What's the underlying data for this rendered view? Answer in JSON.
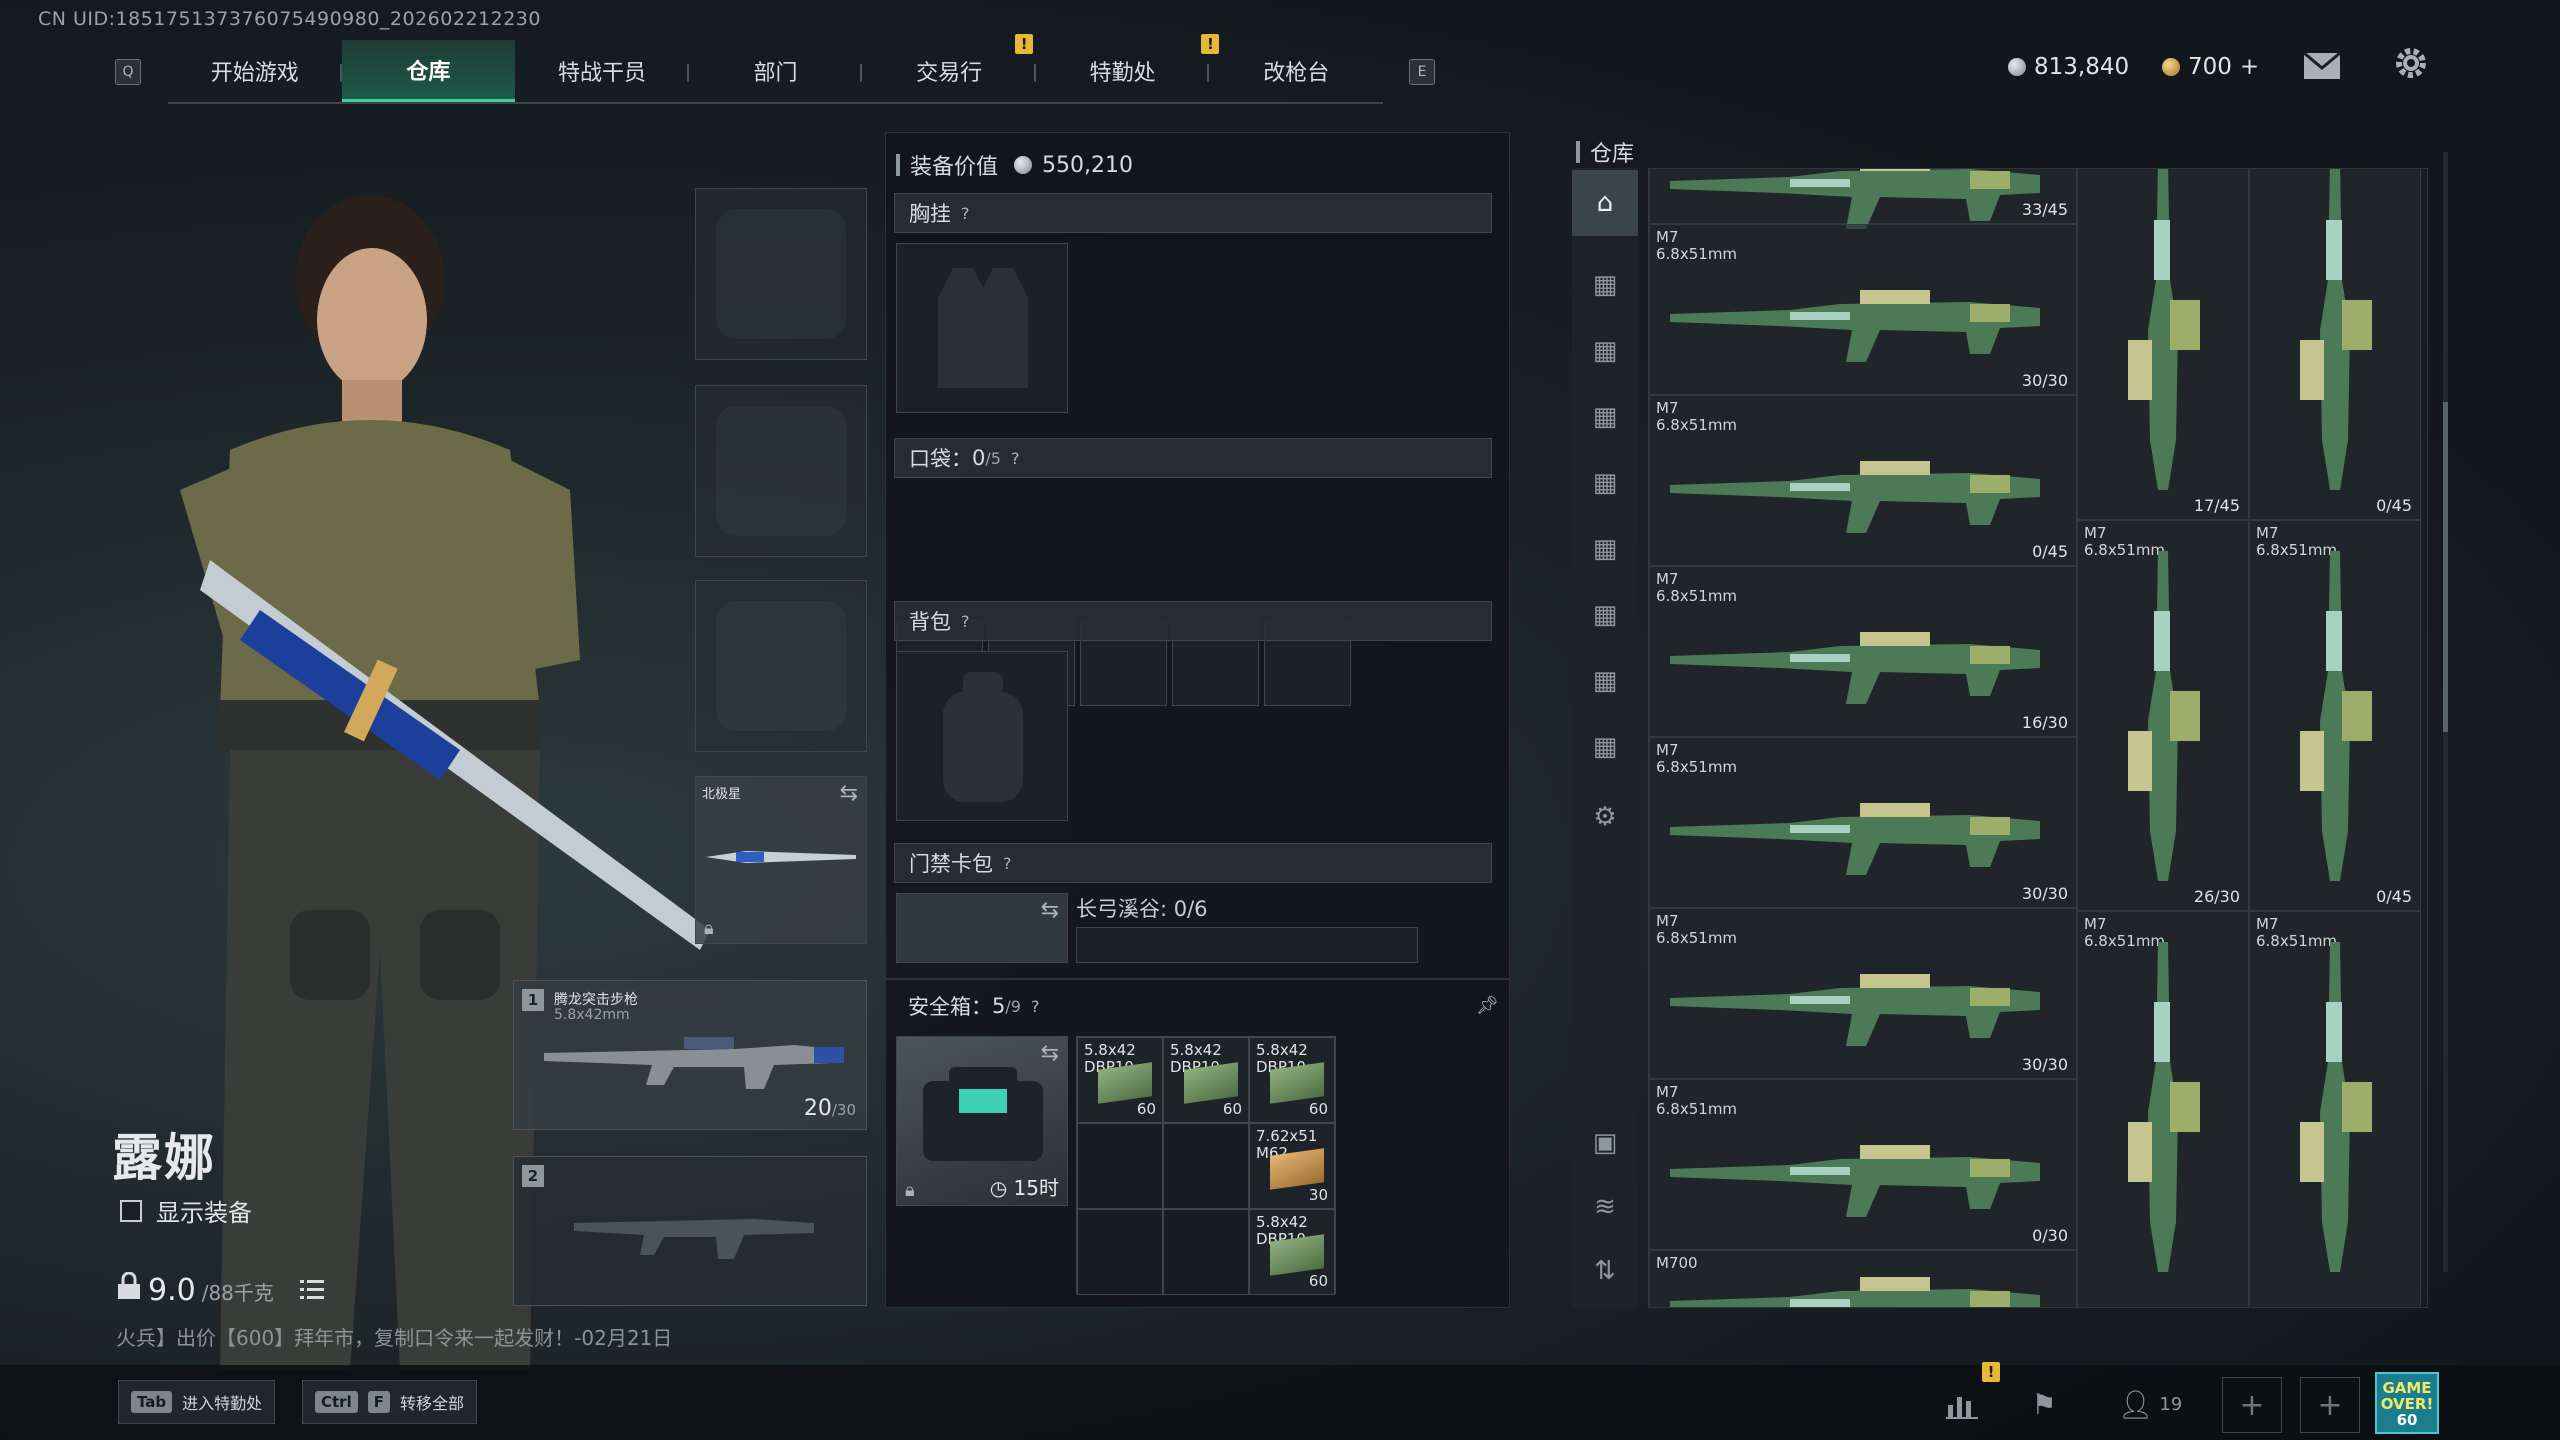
{
  "uid": "CN UID:1851751373760754909​80_202602212230",
  "top": {
    "key_left": "Q",
    "key_right": "E",
    "tabs": [
      "开始游戏",
      "仓库",
      "特战干员",
      "部门",
      "交易行",
      "特勤处",
      "改枪台"
    ],
    "active_tab": "仓库",
    "currency_silver": "813,840",
    "currency_gold": "700",
    "gold_plus": "+"
  },
  "character": {
    "name": "露娜",
    "show_equipment_label": "显示装备",
    "weight": "9.0",
    "weight_max": "/88千克",
    "ticker": "火兵】出价【600】拜年市，复制口令来一起发财！-02月21日"
  },
  "slots": {
    "melee_label": "北极星",
    "weapon1": {
      "number": "1",
      "name": "腾龙突击步枪",
      "caliber": "5.8x42mm",
      "ammo": "20",
      "ammo_max": "/30"
    },
    "weapon2": {
      "number": "2"
    }
  },
  "equipment": {
    "title": "装备价值",
    "value": "550,210",
    "chest_rig": "胸挂",
    "pocket_label": "口袋：",
    "pocket_count": "0",
    "pocket_max": "/5",
    "backpack": "背包",
    "keycard": "门禁卡包",
    "keycard_info": "长弓溪谷: 0/6",
    "safebox_label": "安全箱：",
    "safebox_count": "5",
    "safebox_max": "/9",
    "safebox_timer": "15时",
    "help": "?"
  },
  "safebox_items": [
    {
      "name": "5.8x42",
      "sub": "DBP10",
      "count": "60"
    },
    {
      "name": "5.8x42",
      "sub": "DBP10",
      "count": "60"
    },
    {
      "name": "5.8x42",
      "sub": "DBP10",
      "count": "60"
    },
    {
      "name": "7.62x51",
      "sub": "M62",
      "count": "30"
    },
    {
      "name": "5.8x42",
      "sub": "DBP10",
      "count": "60"
    }
  ],
  "warehouse": {
    "title": "仓库",
    "items": [
      {
        "name": "",
        "cal": "",
        "count": "33/45"
      },
      {
        "name": "M7",
        "cal": "6.8x51mm",
        "count": "30/30"
      },
      {
        "name": "M7",
        "cal": "6.8x51mm",
        "count": "0/45"
      },
      {
        "name": "M7",
        "cal": "6.8x51mm",
        "count": "16/30"
      },
      {
        "name": "M7",
        "cal": "6.8x51mm",
        "count": "30/30"
      },
      {
        "name": "M7",
        "cal": "6.8x51mm",
        "count": "30/30"
      },
      {
        "name": "M7",
        "cal": "6.8x51mm",
        "count": "0/30"
      },
      {
        "name": "",
        "cal": "",
        "count": "17/45"
      },
      {
        "name": "",
        "cal": "",
        "count": "0/45"
      },
      {
        "name": "M7",
        "cal": "6.8x51mm",
        "count": "26/30"
      },
      {
        "name": "M7",
        "cal": "6.8x51mm",
        "count": "0/45"
      },
      {
        "name": "M7",
        "cal": "6.8x51mm",
        "count": ""
      },
      {
        "name": "M7",
        "cal": "6.8x51mm",
        "count": ""
      },
      {
        "name": "M700",
        "cal": "",
        "count": ""
      }
    ]
  },
  "bottom": {
    "tab_key": "Tab",
    "tab_label": "进入特勤处",
    "ctrl_key": "Ctrl",
    "f_key": "F",
    "ctrl_label": "转移全部",
    "friends": "19",
    "game_over": "GAME OVER!",
    "game_num": "60"
  },
  "colors": {
    "accent": "#3ed29a",
    "alert": "#e7b73a",
    "gold": "#d9a94a",
    "silver": "#b9c0c4"
  }
}
